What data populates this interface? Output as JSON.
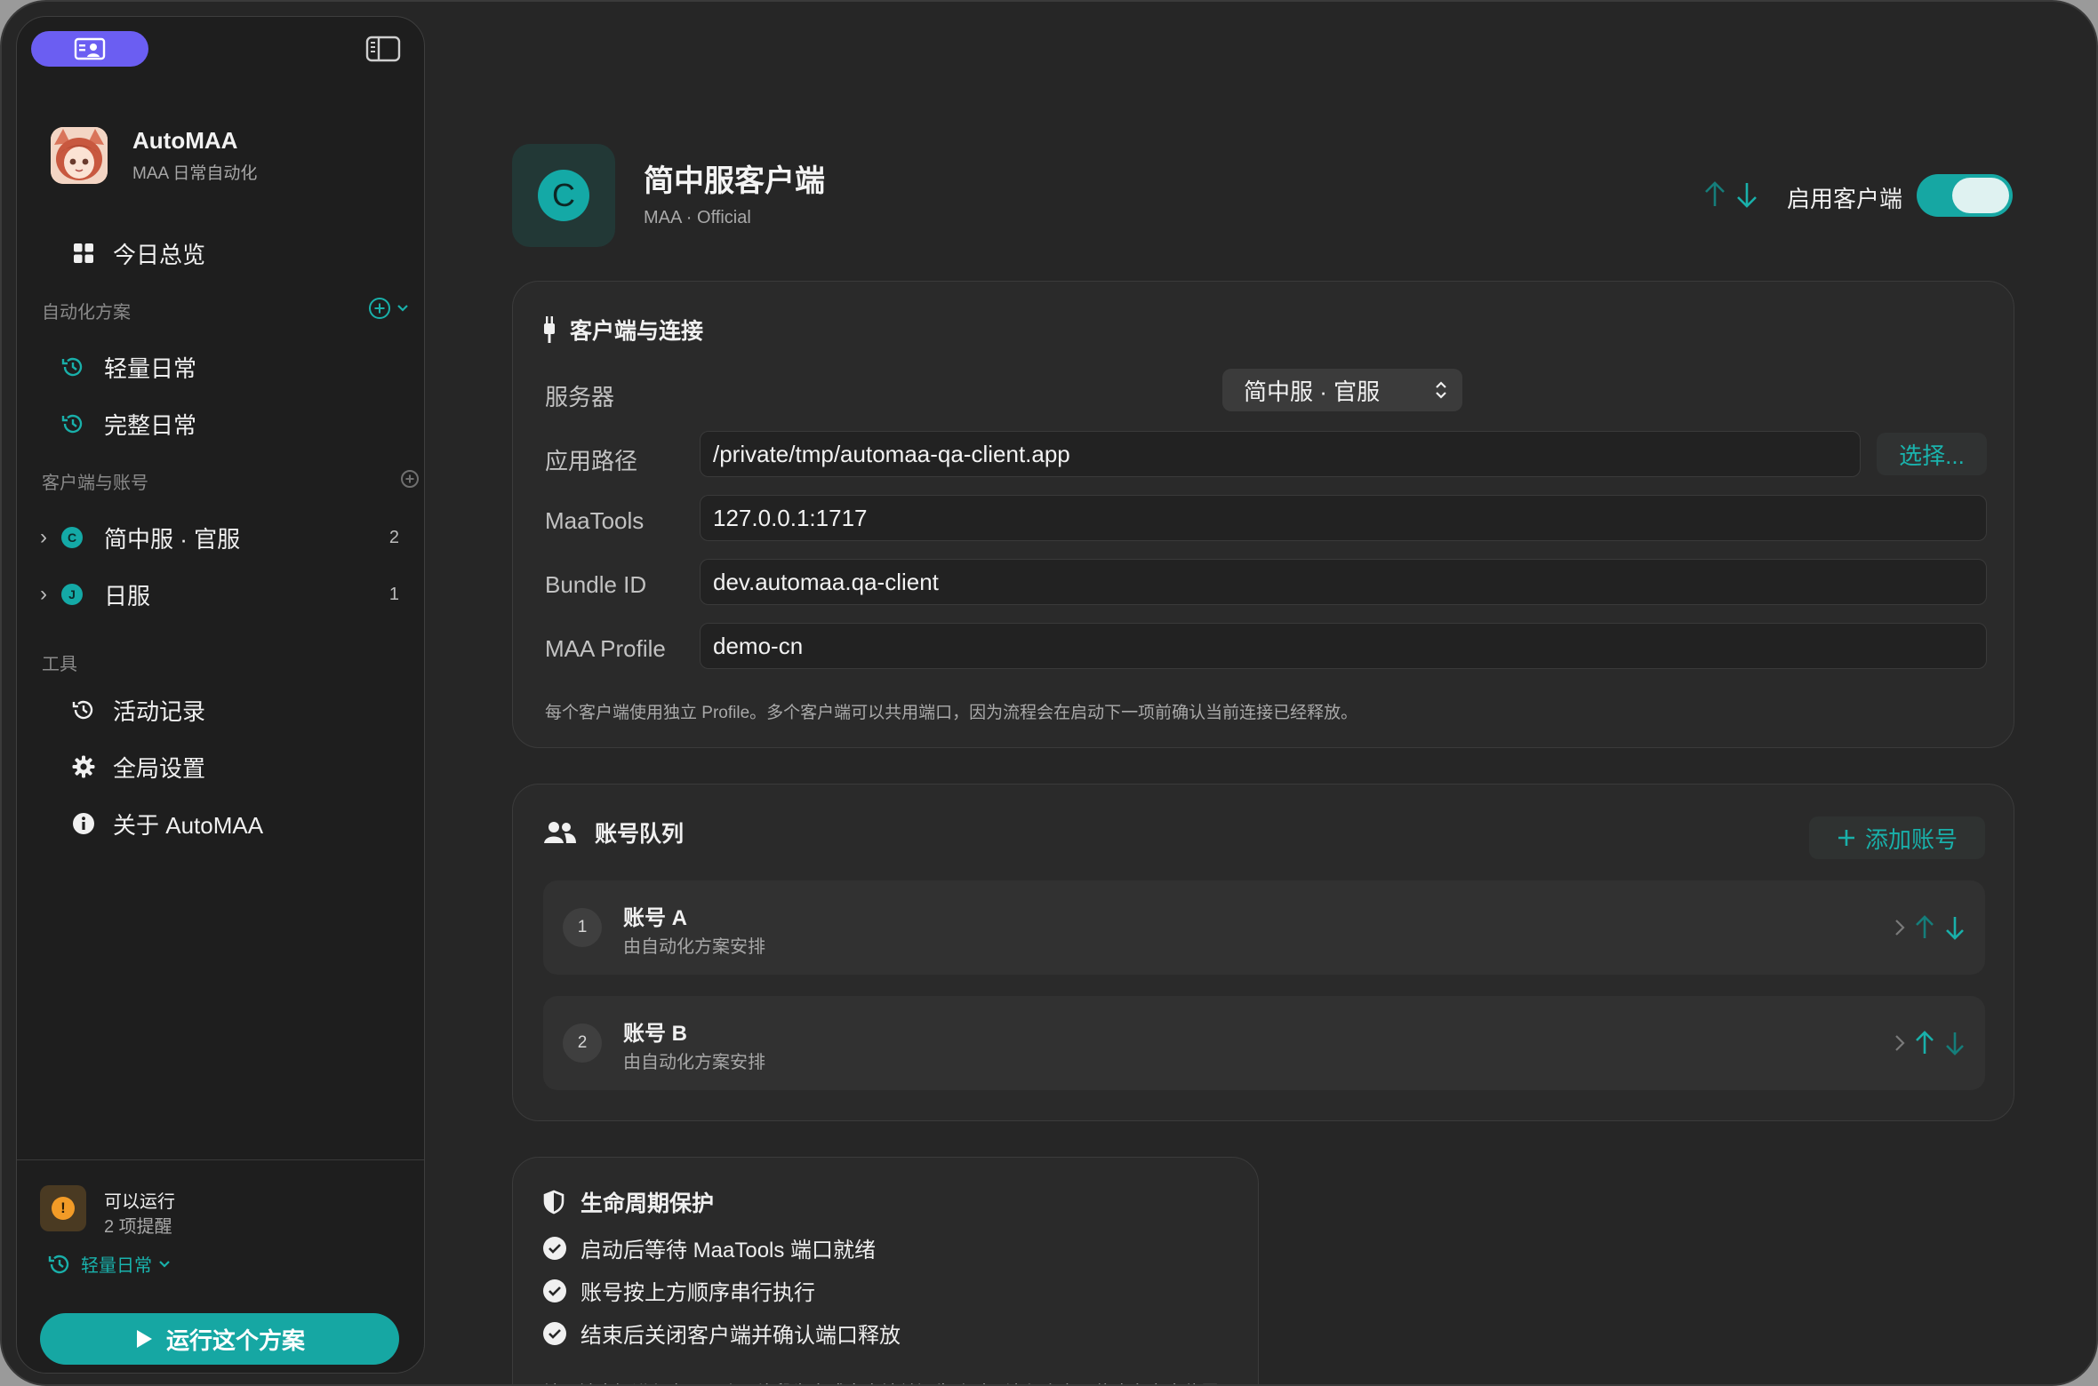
{
  "window": {
    "title": "AutoMAA"
  },
  "sidebar": {
    "app_name": "AutoMAA",
    "app_subtitle": "MAA 日常自动化",
    "overview": "今日总览",
    "plans_section": "自动化方案",
    "plans": [
      {
        "label": "轻量日常"
      },
      {
        "label": "完整日常"
      }
    ],
    "clients_section": "客户端与账号",
    "clients": [
      {
        "label": "简中服 · 官服",
        "badge": "C",
        "count": "2"
      },
      {
        "label": "日服",
        "badge": "J",
        "count": "1"
      }
    ],
    "tools_section": "工具",
    "tools": [
      {
        "label": "活动记录"
      },
      {
        "label": "全局设置"
      },
      {
        "label": "关于 AutoMAA"
      }
    ],
    "footer": {
      "status": "可以运行",
      "warnings": "2 项提醒",
      "warning_glyph": "!",
      "current_plan": "轻量日常",
      "run_label": "运行这个方案"
    }
  },
  "header": {
    "icon_letter": "C",
    "title": "简中服客户端",
    "subtitle": "MAA · Official",
    "enable_label": "启用客户端",
    "enabled": true
  },
  "connection": {
    "title": "客户端与连接",
    "server_label": "服务器",
    "server_value": "简中服 · 官服",
    "path_label": "应用路径",
    "path_value": "/private/tmp/automaa-qa-client.app",
    "choose_label": "选择...",
    "maatools_label": "MaaTools",
    "maatools_value": "127.0.0.1:1717",
    "bundle_label": "Bundle ID",
    "bundle_value": "dev.automaa.qa-client",
    "profile_label": "MAA Profile",
    "profile_value": "demo-cn",
    "hint": "每个客户端使用独立 Profile。多个客户端可以共用端口，因为流程会在启动下一项前确认当前连接已经释放。"
  },
  "accounts": {
    "title": "账号队列",
    "add_label": "添加账号",
    "items": [
      {
        "index": "1",
        "name": "账号 A",
        "desc": "由自动化方案安排"
      },
      {
        "index": "2",
        "name": "账号 B",
        "desc": "由自动化方案安排"
      }
    ]
  },
  "lifecycle": {
    "title": "生命周期保护",
    "items": [
      {
        "label": "启动后等待 MaaTools 端口就绪"
      },
      {
        "label": "账号按上方顺序串行执行"
      },
      {
        "label": "结束后关闭客户端并确认端口释放"
      }
    ],
    "note": "端口被未知进程占用、账号片段为空或客户端关闭失败时，流程会立即停止在安全位置。"
  },
  "colors": {
    "accent": "#16a7a3",
    "sidebar_button": "#6b5ef2",
    "warning": "#f29b27",
    "background": "#262626"
  }
}
